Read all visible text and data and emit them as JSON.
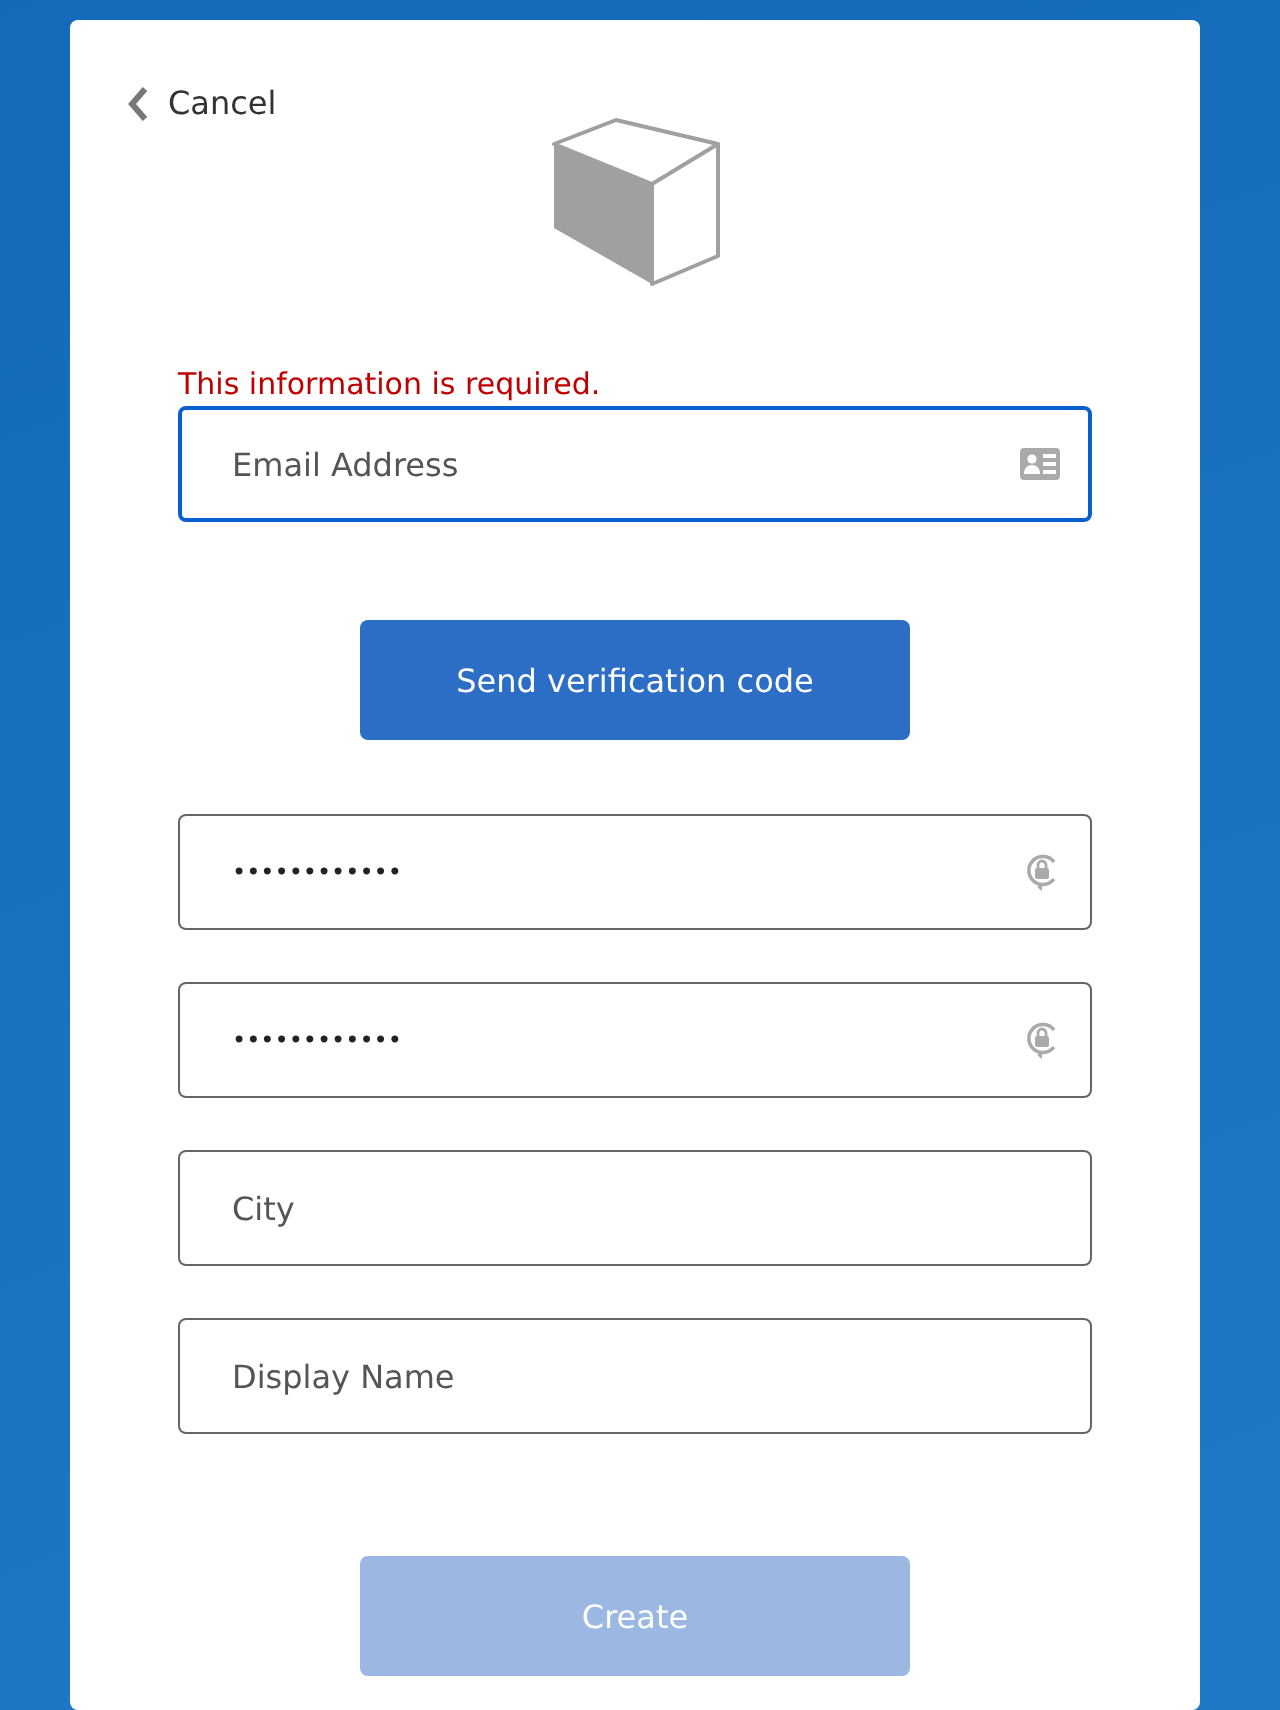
{
  "header": {
    "back_label": "Cancel"
  },
  "error": "This information is required.",
  "fields": [
    {
      "kind": "email",
      "placeholder": "Email Address",
      "focused": true
    },
    {
      "kind": "password",
      "value": "••••••••••••",
      "focused": false
    },
    {
      "kind": "password",
      "value": "••••••••••••",
      "focused": false
    },
    {
      "kind": "text",
      "placeholder": "City",
      "focused": false
    },
    {
      "kind": "text",
      "placeholder": "Display Name",
      "focused": false
    }
  ],
  "send_button": {
    "label": "Send verification code",
    "disabled": false
  },
  "create_button": {
    "label": "Create",
    "disabled": true
  }
}
